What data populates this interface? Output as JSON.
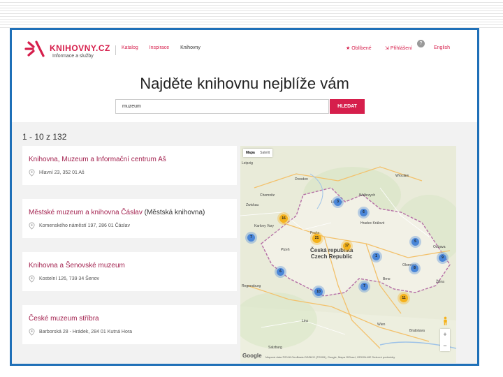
{
  "header": {
    "logo_name": "KNIHOVNY.CZ",
    "logo_sub": "Informace a služby",
    "nav": [
      "Katalog",
      "Inspirace",
      "Knihovny"
    ],
    "favorites": "Oblíbené",
    "login": "Přihlášení",
    "help": "?",
    "language": "English",
    "accent_color": "#d61f4c"
  },
  "main": {
    "headline": "Najděte knihovnu nejblíže vám",
    "search_value": "muzeum",
    "search_button": "HLEDAT",
    "results_count": "1 - 10 z 132"
  },
  "results": [
    {
      "title": "Knihovna, Muzeum a Informační centrum Aš",
      "suffix": "",
      "address": "Hlavní 23, 352 01 Aš"
    },
    {
      "title": "Městské muzeum a knihovna Čáslav",
      "suffix": " (Městská knihovna)",
      "address": "Komenského náměstí 197, 286 01 Čáslav"
    },
    {
      "title": "Knihovna a Šenovské muzeum",
      "suffix": "",
      "address": "Kostelní 126, 739 34 Šenov"
    },
    {
      "title": "České muzeum stříbra",
      "suffix": "",
      "address": "Barborská 28 - Hrádek, 284 01 Kutná Hora"
    }
  ],
  "map": {
    "tabs": [
      "Mapa",
      "Satelit"
    ],
    "country": "Česká republika",
    "country_en": "Czech Republic",
    "cities": [
      "Leipzig",
      "Dresden",
      "Wrocław",
      "Chemnitz",
      "Zwickau",
      "Liberec",
      "Praha",
      "Plzeň",
      "Brno",
      "Ostrava",
      "Olomouc",
      "Wien",
      "Bratislava",
      "Salzburg",
      "Linz",
      "Regensburg",
      "Hradec Králové",
      "Karlovy Vary",
      "Žilina",
      "Wałbrzych"
    ],
    "clusters": [
      {
        "label": "3",
        "color": "blue"
      },
      {
        "label": "6",
        "color": "blue"
      },
      {
        "label": "16",
        "color": "orange"
      },
      {
        "label": "7",
        "color": "blue"
      },
      {
        "label": "21",
        "color": "orange"
      },
      {
        "label": "17",
        "color": "orange"
      },
      {
        "label": "5",
        "color": "blue"
      },
      {
        "label": "1",
        "color": "blue"
      },
      {
        "label": "9",
        "color": "blue"
      },
      {
        "label": "6",
        "color": "blue"
      },
      {
        "label": "8",
        "color": "blue"
      },
      {
        "label": "10",
        "color": "blue"
      },
      {
        "label": "7",
        "color": "blue"
      },
      {
        "label": "11",
        "color": "orange"
      }
    ],
    "zoom_in": "+",
    "zoom_out": "−",
    "google": "Google",
    "copyright": "Mapová data ©2018 GeoBasis-DE/BKG (©2009), Google, Mapa GISrael, ORION-ME   Smluvní podmínky"
  }
}
